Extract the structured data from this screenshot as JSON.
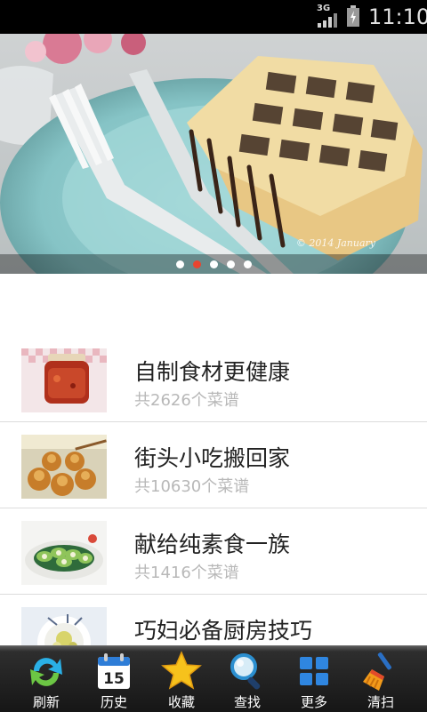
{
  "status_bar": {
    "network": "3G",
    "time": "11:10"
  },
  "banner": {
    "watermark": "© 2014 January",
    "active_slide": 2,
    "slide_count": 5
  },
  "categories": [
    {
      "title": "自制食材更健康",
      "count": "共2626个菜谱"
    },
    {
      "title": "街头小吃搬回家",
      "count": "共10630个菜谱"
    },
    {
      "title": "献给纯素食一族",
      "count": "共1416个菜谱"
    },
    {
      "title": "巧妇必备厨房技巧",
      "count": ""
    }
  ],
  "bottom_nav": [
    {
      "label": "刷新",
      "icon": "refresh-icon"
    },
    {
      "label": "历史",
      "icon": "calendar-icon"
    },
    {
      "label": "收藏",
      "icon": "star-icon"
    },
    {
      "label": "查找",
      "icon": "magnifier-icon"
    },
    {
      "label": "更多",
      "icon": "grid-icon"
    },
    {
      "label": "清扫",
      "icon": "broom-icon"
    }
  ],
  "calendar_day": "15",
  "colors": {
    "active_dot": "#e8442f",
    "status_bar": "#000000",
    "nav_bar": "#1a1a1a"
  }
}
